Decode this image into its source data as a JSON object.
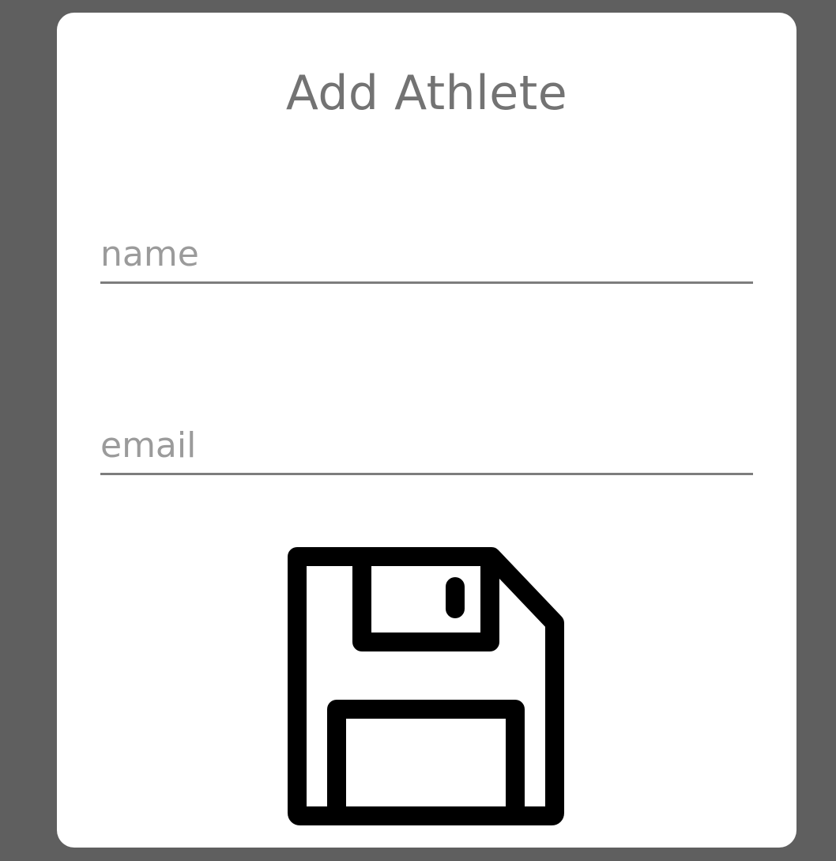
{
  "dialog": {
    "title": "Add Athlete",
    "fields": {
      "name": {
        "placeholder": "name",
        "value": ""
      },
      "email": {
        "placeholder": "email",
        "value": ""
      }
    },
    "save_icon": "floppy-disk-save-icon"
  },
  "colors": {
    "overlay": "#5f5f5f",
    "dialog_background": "#ffffff",
    "title_text": "#737373",
    "placeholder_text": "#9b9b9b",
    "underline": "#7d7d7d",
    "icon": "#000000"
  }
}
